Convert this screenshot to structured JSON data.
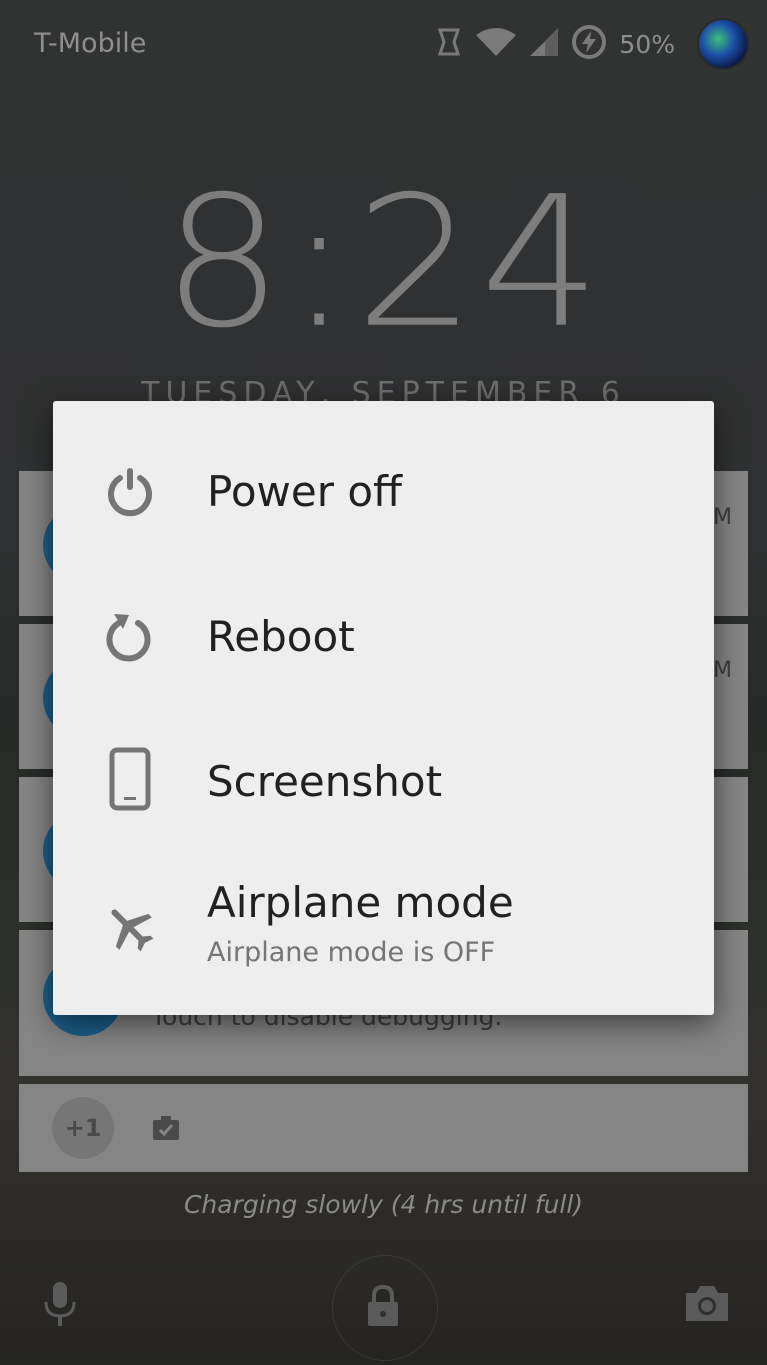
{
  "status_bar": {
    "carrier": "T-Mobile",
    "battery": "50%",
    "icons": [
      "nfc-icon",
      "wifi-icon",
      "signal-icon",
      "charging-icon",
      "profile-avatar"
    ]
  },
  "lockscreen": {
    "time": "8:24",
    "date": "TUESDAY, SEPTEMBER 6",
    "notification_fragments": {
      "time_suffix_1": "M",
      "time_suffix_2": "M",
      "debug_text": "Touch to disable debugging."
    },
    "overflow_count": "+1",
    "charging_status": "Charging slowly (4 hrs until full)",
    "bottom_icons": [
      "microphone-icon",
      "lock-icon",
      "camera-icon"
    ]
  },
  "power_menu": {
    "items": [
      {
        "label": "Power off",
        "icon": "power-icon"
      },
      {
        "label": "Reboot",
        "icon": "reboot-icon"
      },
      {
        "label": "Screenshot",
        "icon": "phone-icon"
      },
      {
        "label": "Airplane mode",
        "sublabel": "Airplane mode is OFF",
        "icon": "airplane-icon"
      }
    ]
  },
  "colors": {
    "dialog_bg": "#eeeeee",
    "icon_gray": "#757575",
    "text_dark": "#212121"
  }
}
